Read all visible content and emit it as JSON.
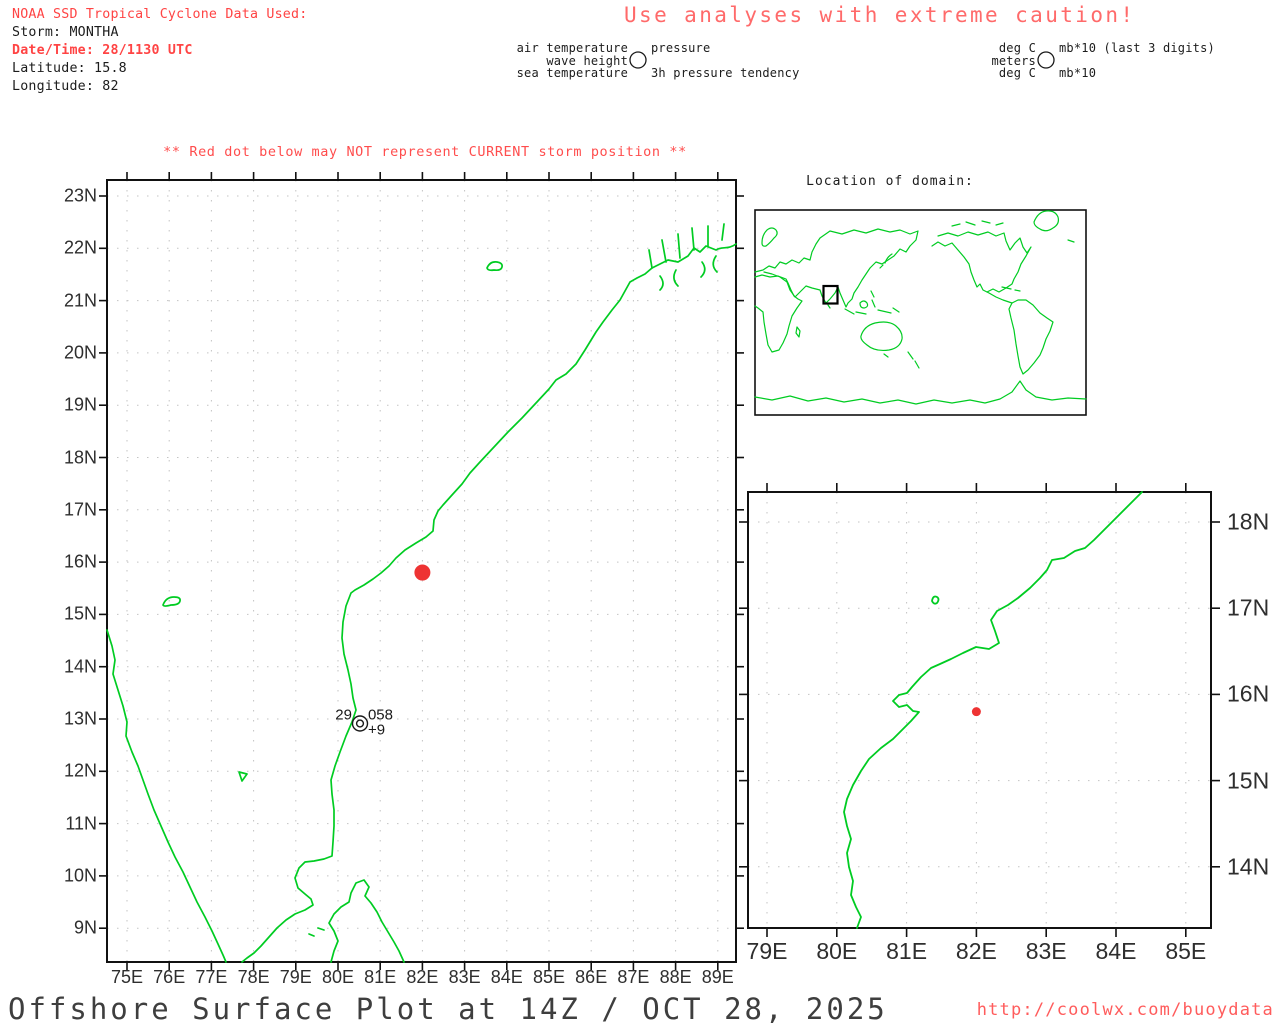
{
  "header": {
    "source_line": "NOAA SSD Tropical Cyclone Data Used:",
    "storm_line": "Storm: MONTHA",
    "datetime_line": "Date/Time: 28/1130 UTC",
    "latitude_line": "Latitude: 15.8",
    "longitude_line": "Longitude: 82"
  },
  "caution_banner": "Use analyses with extreme caution!",
  "station_model_legend": {
    "air_temp_label": "air temperature",
    "wave_height_label": "wave height",
    "sea_temp_label": "sea temperature",
    "pressure_label": "pressure",
    "tendency_label": "3h pressure tendency"
  },
  "units_legend": {
    "air_temp_units": "deg C",
    "wave_height_units": "meters",
    "sea_temp_units": "deg C",
    "pressure_units": "mb*10 (last 3 digits)",
    "tendency_units": "mb*10"
  },
  "warning_line": "** Red dot below may NOT represent CURRENT storm position **",
  "inset": {
    "title": "Location of domain:"
  },
  "footer": {
    "title": "Offshore Surface Plot at 14Z / OCT 28, 2025",
    "url": "http://coolwx.com/buoydata"
  },
  "colors": {
    "coastline_green": "#00cc22",
    "storm_red": "#ee3333",
    "header_red": "#ff4444",
    "caution_red": "#ff6a6a",
    "warning_red": "#ff4d4d",
    "url_red": "#ff5c5c",
    "grid_gray": "#c3c3c3"
  },
  "chart_data": [
    {
      "type": "map",
      "name": "main-map",
      "region": "Bay of Bengal / East coast of India",
      "lon_ticks": [
        "75E",
        "76E",
        "77E",
        "78E",
        "79E",
        "80E",
        "81E",
        "82E",
        "83E",
        "84E",
        "85E",
        "86E",
        "87E",
        "88E",
        "89E"
      ],
      "lat_ticks": [
        "23N",
        "22N",
        "21N",
        "20N",
        "19N",
        "18N",
        "17N",
        "16N",
        "15N",
        "14N",
        "13N",
        "12N",
        "11N",
        "10N",
        "9N"
      ],
      "lon_tick_values": [
        75,
        76,
        77,
        78,
        79,
        80,
        81,
        82,
        83,
        84,
        85,
        86,
        87,
        88,
        89
      ],
      "lat_tick_values": [
        23,
        22,
        21,
        20,
        19,
        18,
        17,
        16,
        15,
        14,
        13,
        12,
        11,
        10,
        9
      ],
      "grid": true,
      "storm_marker": {
        "lon": 82,
        "lat": 15.8
      },
      "station_plot": {
        "lon": 80.52,
        "lat": 12.9,
        "air_temperature": "29",
        "pressure": "058",
        "pressure_tendency": "+9"
      }
    },
    {
      "type": "map",
      "name": "zoom-map",
      "region": "Storm-centered zoom",
      "lon_ticks": [
        "79E",
        "80E",
        "81E",
        "82E",
        "83E",
        "84E",
        "85E"
      ],
      "lat_ticks": [
        "18N",
        "17N",
        "16N",
        "15N",
        "14N"
      ],
      "lon_tick_values": [
        79,
        80,
        81,
        82,
        83,
        84,
        85
      ],
      "lat_tick_values": [
        18,
        17,
        16,
        15,
        14
      ],
      "grid": true,
      "storm_marker": {
        "lon": 82,
        "lat": 15.8
      }
    },
    {
      "type": "map",
      "name": "world-inset",
      "region": "World (Pacific centered)",
      "domain_box": {
        "lon_min": 74.5,
        "lon_max": 89.4,
        "lat_min": 8.3,
        "lat_max": 23.3
      }
    }
  ]
}
